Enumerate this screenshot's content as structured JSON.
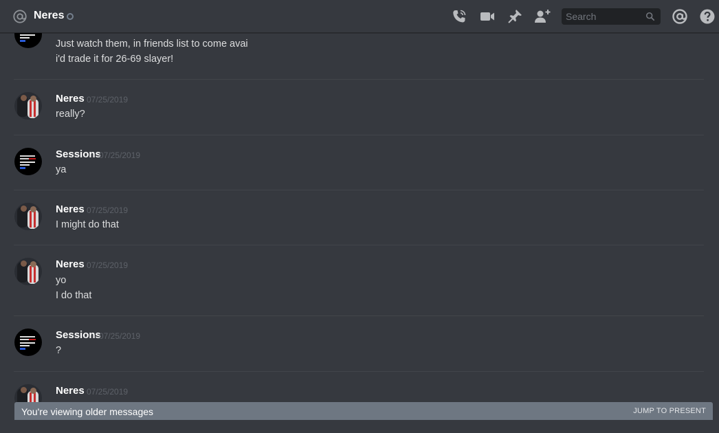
{
  "header": {
    "channel_name": "Neres",
    "search_placeholder": "Search",
    "icons": [
      "at-icon",
      "status-offline-icon",
      "call-icon",
      "video-icon",
      "pin-icon",
      "add-friend-icon",
      "search-icon",
      "mentions-icon",
      "help-icon"
    ]
  },
  "colors": {
    "background": "#36393f",
    "header_border": "#26282c",
    "divider": "#42454a",
    "search_bg": "#202225",
    "older_bar": "#6e7782",
    "username": "#ffffff",
    "timestamp": "#5d6168",
    "message_text": "#dcddde"
  },
  "messages": [
    {
      "author": "",
      "timestamp": "",
      "lines": [
        "Just watch them, in friends list to come avai",
        "i'd trade it for 26-69 slayer!"
      ]
    },
    {
      "author": "Neres",
      "timestamp": "07/25/2019",
      "lines": [
        "really?"
      ]
    },
    {
      "author": "Sessions",
      "timestamp": "07/25/2019",
      "lines": [
        "ya"
      ]
    },
    {
      "author": "Neres",
      "timestamp": "07/25/2019",
      "lines": [
        "I might do that"
      ]
    },
    {
      "author": "Neres",
      "timestamp": "07/25/2019",
      "lines": [
        "yo",
        "I do that"
      ]
    },
    {
      "author": "Sessions",
      "timestamp": "07/25/2019",
      "lines": [
        "?"
      ]
    },
    {
      "author": "Neres",
      "timestamp": "07/25/2019",
      "lines": []
    }
  ],
  "older_bar": {
    "text": "You're viewing older messages",
    "jump_label": "JUMP TO PRESENT"
  }
}
